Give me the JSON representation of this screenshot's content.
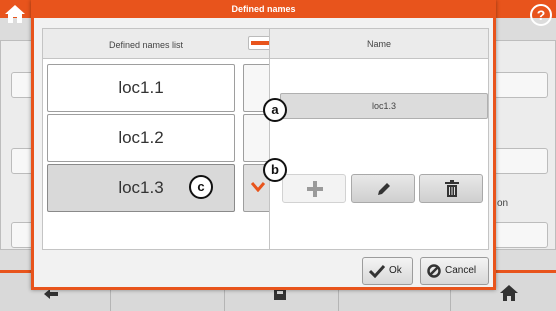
{
  "dialog": {
    "title": "Defined names",
    "list_header": "Defined names list",
    "edit_header": "Name",
    "items": [
      {
        "label": "loc1.1"
      },
      {
        "label": "loc1.2"
      },
      {
        "label": "loc1.3"
      }
    ],
    "selected_index": 2,
    "current_name": "loc1.3",
    "ok_label": "Ok",
    "cancel_label": "Cancel"
  },
  "markers": {
    "a": "a",
    "b": "b",
    "c": "c"
  },
  "background": {
    "partial_label": "on"
  },
  "topbar": {
    "help_glyph": "?"
  },
  "icons": {
    "home": "home-icon",
    "help": "help-icon",
    "add": "plus-icon",
    "edit": "pencil-icon",
    "delete": "trash-icon",
    "ok": "checkmark-icon",
    "cancel": "cancel-icon"
  },
  "colors": {
    "accent": "#e8541c",
    "selected_item": "#d9d9d9"
  }
}
